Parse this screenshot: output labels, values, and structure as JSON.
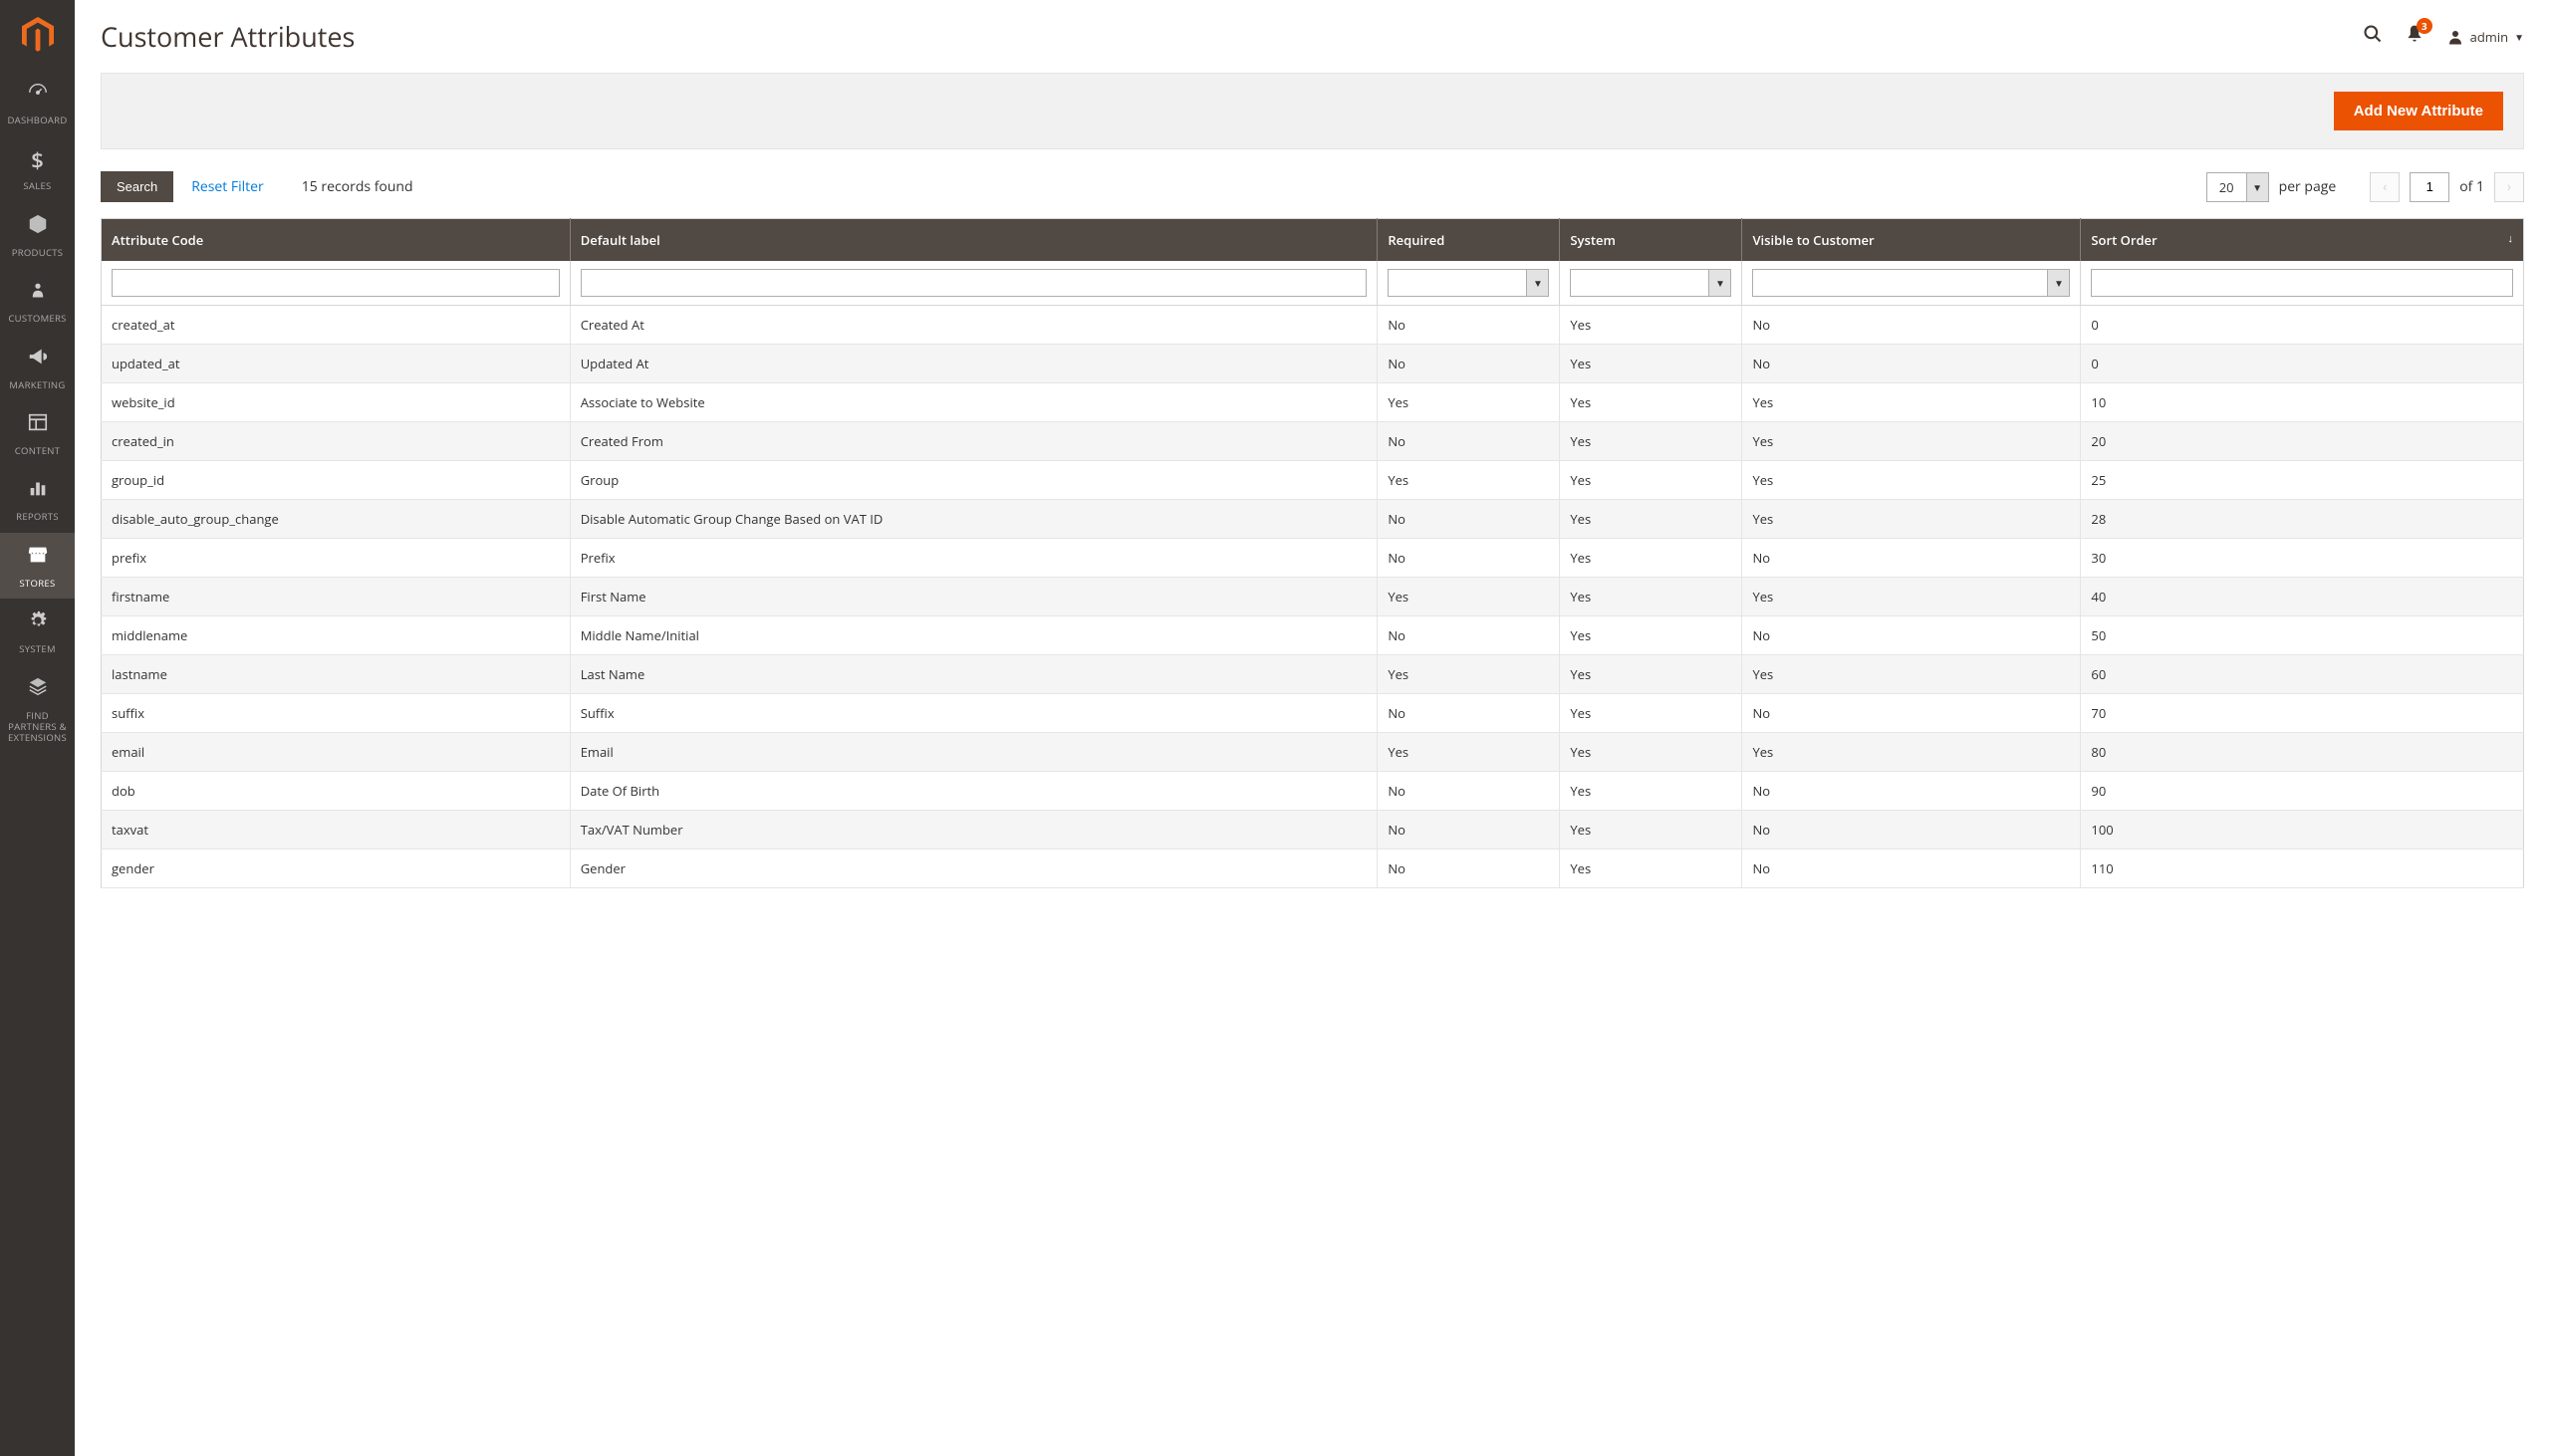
{
  "page": {
    "title": "Customer Attributes"
  },
  "header": {
    "notif_count": "3",
    "user_label": "admin"
  },
  "action_bar": {
    "add_button": "Add New Attribute"
  },
  "toolbar": {
    "search": "Search",
    "reset": "Reset Filter",
    "records_found": "15 records found",
    "per_page_value": "20",
    "per_page_label": "per page",
    "page_current": "1",
    "page_total": "of 1"
  },
  "sidebar": {
    "items": [
      {
        "label": "DASHBOARD",
        "icon": "speedometer"
      },
      {
        "label": "SALES",
        "icon": "dollar"
      },
      {
        "label": "PRODUCTS",
        "icon": "box"
      },
      {
        "label": "CUSTOMERS",
        "icon": "person"
      },
      {
        "label": "MARKETING",
        "icon": "megaphone"
      },
      {
        "label": "CONTENT",
        "icon": "layout"
      },
      {
        "label": "REPORTS",
        "icon": "bars"
      },
      {
        "label": "STORES",
        "icon": "storefront",
        "active": true
      },
      {
        "label": "SYSTEM",
        "icon": "gear"
      },
      {
        "label": "FIND PARTNERS & EXTENSIONS",
        "icon": "partners"
      }
    ]
  },
  "table": {
    "columns": [
      {
        "label": "Attribute Code",
        "key": "code"
      },
      {
        "label": "Default label",
        "key": "label"
      },
      {
        "label": "Required",
        "key": "required"
      },
      {
        "label": "System",
        "key": "system"
      },
      {
        "label": "Visible to Customer",
        "key": "visible"
      },
      {
        "label": "Sort Order",
        "key": "sort"
      }
    ],
    "rows": [
      {
        "code": "created_at",
        "label": "Created At",
        "required": "No",
        "system": "Yes",
        "visible": "No",
        "sort": "0"
      },
      {
        "code": "updated_at",
        "label": "Updated At",
        "required": "No",
        "system": "Yes",
        "visible": "No",
        "sort": "0"
      },
      {
        "code": "website_id",
        "label": "Associate to Website",
        "required": "Yes",
        "system": "Yes",
        "visible": "Yes",
        "sort": "10"
      },
      {
        "code": "created_in",
        "label": "Created From",
        "required": "No",
        "system": "Yes",
        "visible": "Yes",
        "sort": "20"
      },
      {
        "code": "group_id",
        "label": "Group",
        "required": "Yes",
        "system": "Yes",
        "visible": "Yes",
        "sort": "25"
      },
      {
        "code": "disable_auto_group_change",
        "label": "Disable Automatic Group Change Based on VAT ID",
        "required": "No",
        "system": "Yes",
        "visible": "Yes",
        "sort": "28"
      },
      {
        "code": "prefix",
        "label": "Prefix",
        "required": "No",
        "system": "Yes",
        "visible": "No",
        "sort": "30"
      },
      {
        "code": "firstname",
        "label": "First Name",
        "required": "Yes",
        "system": "Yes",
        "visible": "Yes",
        "sort": "40"
      },
      {
        "code": "middlename",
        "label": "Middle Name/Initial",
        "required": "No",
        "system": "Yes",
        "visible": "No",
        "sort": "50"
      },
      {
        "code": "lastname",
        "label": "Last Name",
        "required": "Yes",
        "system": "Yes",
        "visible": "Yes",
        "sort": "60"
      },
      {
        "code": "suffix",
        "label": "Suffix",
        "required": "No",
        "system": "Yes",
        "visible": "No",
        "sort": "70"
      },
      {
        "code": "email",
        "label": "Email",
        "required": "Yes",
        "system": "Yes",
        "visible": "Yes",
        "sort": "80"
      },
      {
        "code": "dob",
        "label": "Date Of Birth",
        "required": "No",
        "system": "Yes",
        "visible": "No",
        "sort": "90"
      },
      {
        "code": "taxvat",
        "label": "Tax/VAT Number",
        "required": "No",
        "system": "Yes",
        "visible": "No",
        "sort": "100"
      },
      {
        "code": "gender",
        "label": "Gender",
        "required": "No",
        "system": "Yes",
        "visible": "No",
        "sort": "110"
      }
    ]
  }
}
